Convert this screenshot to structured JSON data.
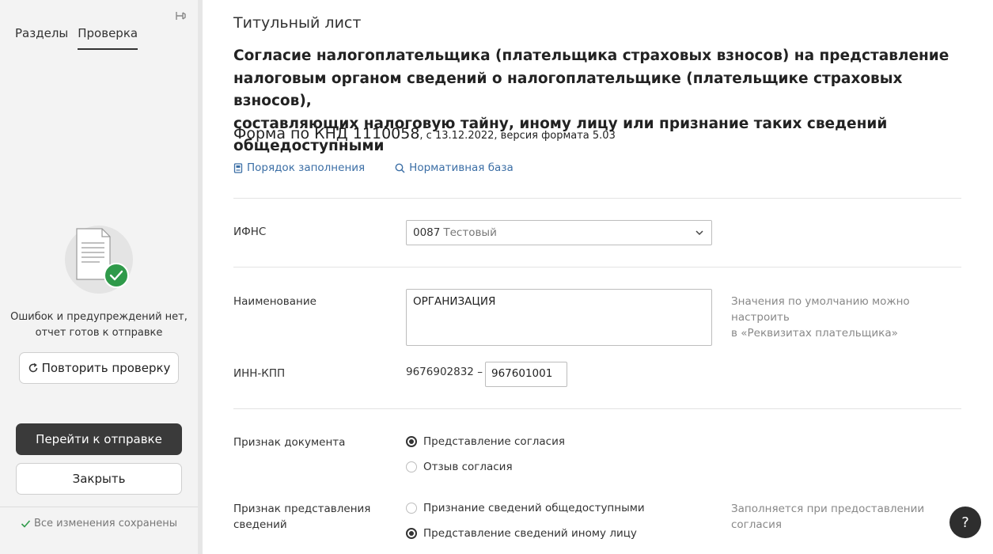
{
  "sidebar": {
    "tabs": [
      {
        "label": "Разделы"
      },
      {
        "label": "Проверка"
      }
    ],
    "status_line1": "Ошибок и предупреждений нет,",
    "status_line2": "отчет готов к отправке",
    "recheck_label": "Повторить проверку",
    "send_label": "Перейти к отправке",
    "close_label": "Закрыть",
    "saved_label": "Все изменения сохранены"
  },
  "main": {
    "page_title": "Титульный лист",
    "form_title_lines": [
      "Согласие налогоплательщика (плательщика страховых взносов) на представление",
      "налоговым органом сведений о налогоплательщике (плательщике страховых взносов),",
      "составляющих налоговую тайну, иному лицу или признание таких сведений общедоступными"
    ],
    "form_code": "Форма по КНД 1110058",
    "form_version": ", с 13.12.2022, версия формата 5.03",
    "links": {
      "fill_order": "Порядок заполнения",
      "normative": "Нормативная база"
    },
    "ifns": {
      "label": "ИФНС",
      "code": "0087",
      "name": "Тестовый"
    },
    "name_field": {
      "label": "Наименование",
      "value": "ОРГАНИЗАЦИЯ",
      "hint_line1": "Значения по умолчанию можно настроить",
      "hint_line2": "в «Реквизитах плательщика»"
    },
    "inn_kpp": {
      "label": "ИНН-КПП",
      "inn": "9676902832",
      "dash": "–",
      "kpp": "967601001"
    },
    "doc_sign": {
      "label": "Признак документа",
      "options": [
        {
          "label": "Представление согласия",
          "checked": true
        },
        {
          "label": "Отзыв согласия",
          "checked": false
        }
      ]
    },
    "info_sign": {
      "label_line1": "Признак представления",
      "label_line2": "сведений",
      "hint": "Заполняется при предоставлении согласия",
      "options": [
        {
          "label": "Признание сведений общедоступными",
          "checked": false
        },
        {
          "label": "Представление сведений иному лицу",
          "checked": true
        }
      ]
    }
  },
  "help_label": "?",
  "colors": {
    "accent_link": "#3b6ea5",
    "success_green": "#2f9a4a",
    "dark_button": "#3a3a3a"
  }
}
